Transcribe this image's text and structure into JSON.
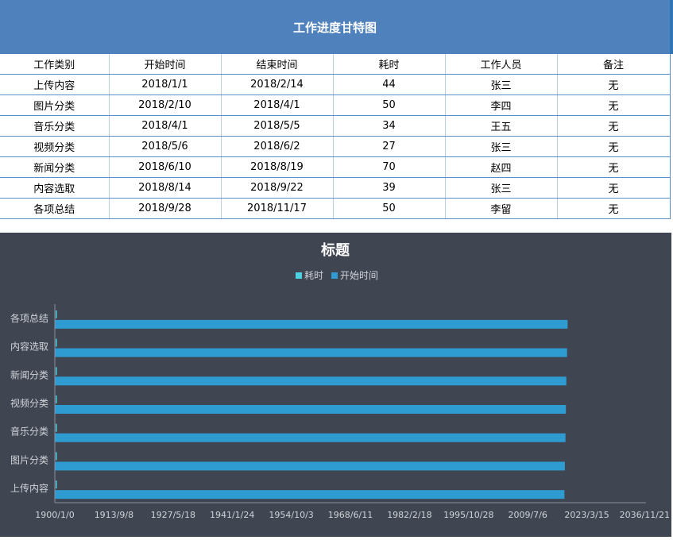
{
  "sheet": {
    "title": "工作进度甘特图",
    "headers": [
      "工作类别",
      "开始时间",
      "结束时间",
      "耗时",
      "工作人员",
      "备注"
    ],
    "rows": [
      [
        "上传内容",
        "2018/1/1",
        "2018/2/14",
        "44",
        "张三",
        "无"
      ],
      [
        "图片分类",
        "2018/2/10",
        "2018/4/1",
        "50",
        "李四",
        "无"
      ],
      [
        "音乐分类",
        "2018/4/1",
        "2018/5/5",
        "34",
        "王五",
        "无"
      ],
      [
        "视频分类",
        "2018/5/6",
        "2018/6/2",
        "27",
        "张三",
        "无"
      ],
      [
        "新闻分类",
        "2018/6/10",
        "2018/8/19",
        "70",
        "赵四",
        "无"
      ],
      [
        "内容选取",
        "2018/8/14",
        "2018/9/22",
        "39",
        "张三",
        "无"
      ],
      [
        "各项总结",
        "2018/9/28",
        "2018/11/17",
        "50",
        "李留",
        "无"
      ]
    ]
  },
  "chart_data": {
    "type": "bar",
    "orientation": "horizontal",
    "stacked": true,
    "title": "标题",
    "categories": [
      "上传内容",
      "图片分类",
      "音乐分类",
      "视频分类",
      "新闻分类",
      "内容选取",
      "各项总结"
    ],
    "series": [
      {
        "name": "耗时",
        "color": "#4dd0e1",
        "values": [
          44,
          50,
          34,
          27,
          70,
          39,
          50
        ]
      },
      {
        "name": "开始时间",
        "color": "#2e9bd1",
        "values": [
          "2018/1/1",
          "2018/2/10",
          "2018/4/1",
          "2018/5/6",
          "2018/6/10",
          "2018/8/14",
          "2018/9/28"
        ]
      }
    ],
    "legend_order": [
      "耗时",
      "开始时间"
    ],
    "legend_position": "top",
    "x_tick_labels": [
      "1900/1/0",
      "1913/9/8",
      "1927/5/18",
      "1941/1/24",
      "1954/10/3",
      "1968/6/11",
      "1982/2/18",
      "1995/10/28",
      "2009/7/6",
      "2023/3/15",
      "2036/11/21"
    ],
    "x_axis": "date",
    "x_range": [
      "1900/1/0",
      "2036/11/21"
    ],
    "grid": false,
    "colors": {
      "background": "#404552",
      "axis_text": "#d0d3d8",
      "title_text": "#ffffff"
    }
  }
}
